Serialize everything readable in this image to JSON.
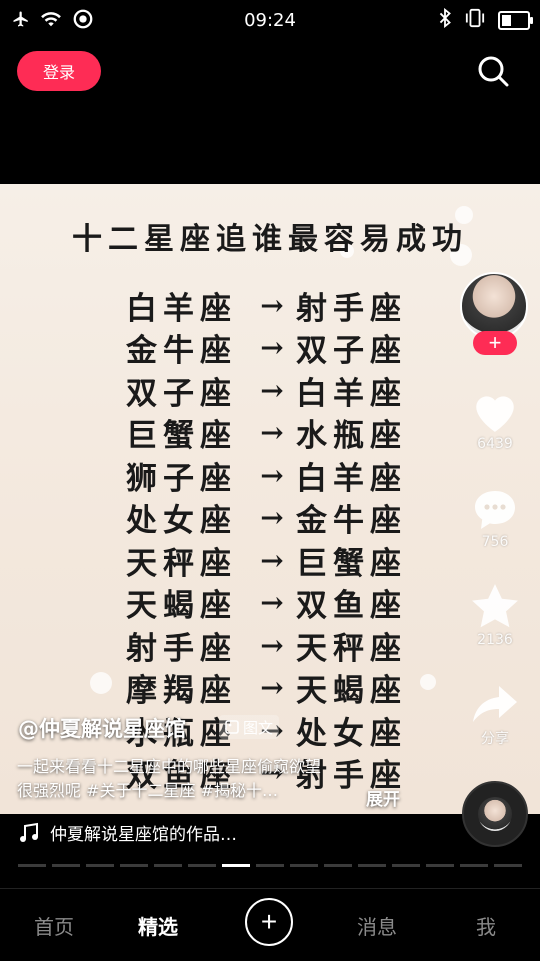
{
  "status_bar": {
    "time": "09:24",
    "icons": [
      "airplane-icon",
      "wifi-icon",
      "sync-icon",
      "bluetooth-icon",
      "vibrate-icon",
      "battery-icon"
    ]
  },
  "header": {
    "login_label": "登录",
    "search_icon": "search-icon"
  },
  "post": {
    "title": "十二星座追谁最容易成功",
    "arrow": "→",
    "pairs": [
      {
        "from": "白羊座",
        "to": "射手座"
      },
      {
        "from": "金牛座",
        "to": "双子座"
      },
      {
        "from": "双子座",
        "to": "白羊座"
      },
      {
        "from": "巨蟹座",
        "to": "水瓶座"
      },
      {
        "from": "狮子座",
        "to": "白羊座"
      },
      {
        "from": "处女座",
        "to": "金牛座"
      },
      {
        "from": "天秤座",
        "to": "巨蟹座"
      },
      {
        "from": "天蝎座",
        "to": "双鱼座"
      },
      {
        "from": "射手座",
        "to": "天秤座"
      },
      {
        "from": "摩羯座",
        "to": "天蝎座"
      },
      {
        "from": "水瓶座",
        "to": "处女座"
      },
      {
        "from": "双鱼座",
        "to": "射手座"
      }
    ]
  },
  "rail": {
    "follow_label": "+",
    "likes": "6439",
    "comments": "756",
    "favorites": "2136",
    "share_label": "分享"
  },
  "caption": {
    "author": "@仲夏解说星座馆",
    "type_tag": "图文",
    "description_line1": "一起来看看十二星座中的哪些星座偷窥欲望",
    "description_line2": "很强烈呢 #关于十二星座 #揭秘十…",
    "expand_label": "展开",
    "music_text": "仲夏解说星座馆的作品…"
  },
  "pager": {
    "total": 15,
    "active_index": 6
  },
  "nav": {
    "items": [
      "首页",
      "精选",
      "消息",
      "我"
    ],
    "plus_label": "+"
  },
  "colors": {
    "accent": "#fe2c55",
    "background": "#000000"
  }
}
